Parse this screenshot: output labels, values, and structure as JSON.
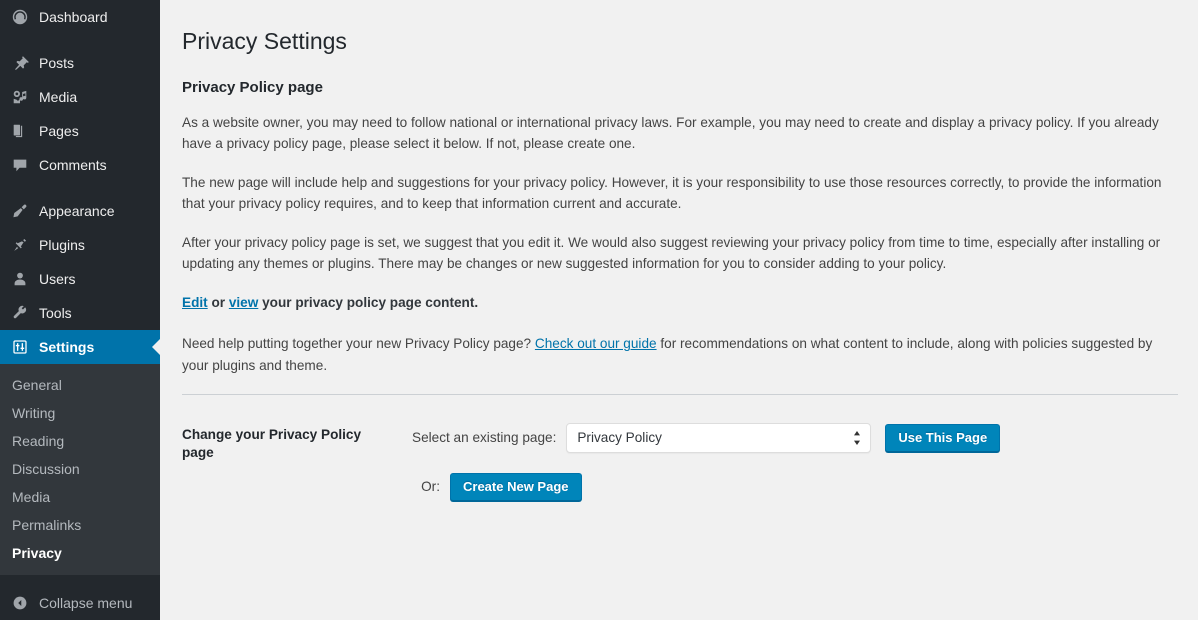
{
  "colors": {
    "menu_bg": "#23282d",
    "submenu_bg": "#32373c",
    "current_blue": "#0073aa",
    "button_blue": "#0085ba",
    "link_blue": "#0073aa",
    "content_bg": "#f1f1f1"
  },
  "sidebar": {
    "items": [
      {
        "label": "Dashboard",
        "icon": "dashboard-gauge-icon",
        "current": false
      },
      {
        "label": "Posts",
        "icon": "pushpin-icon",
        "current": false
      },
      {
        "label": "Media",
        "icon": "media-camera-music-icon",
        "current": false
      },
      {
        "label": "Pages",
        "icon": "pages-stack-icon",
        "current": false
      },
      {
        "label": "Comments",
        "icon": "comment-bubble-icon",
        "current": false
      },
      {
        "label": "Appearance",
        "icon": "paintbrush-icon",
        "current": false
      },
      {
        "label": "Plugins",
        "icon": "plug-icon",
        "current": false
      },
      {
        "label": "Users",
        "icon": "user-person-icon",
        "current": false
      },
      {
        "label": "Tools",
        "icon": "wrench-icon",
        "current": false
      },
      {
        "label": "Settings",
        "icon": "settings-sliders-icon",
        "current": true
      }
    ],
    "submenu": [
      {
        "label": "General",
        "current": false
      },
      {
        "label": "Writing",
        "current": false
      },
      {
        "label": "Reading",
        "current": false
      },
      {
        "label": "Discussion",
        "current": false
      },
      {
        "label": "Media",
        "current": false
      },
      {
        "label": "Permalinks",
        "current": false
      },
      {
        "label": "Privacy",
        "current": true
      }
    ],
    "collapse": {
      "label": "Collapse menu",
      "icon": "collapse-left-arrow-icon"
    }
  },
  "main": {
    "page_title": "Privacy Settings",
    "section_title": "Privacy Policy page",
    "paragraph_1": "As a website owner, you may need to follow national or international privacy laws. For example, you may need to create and display a privacy policy. If you already have a privacy policy page, please select it below. If not, please create one.",
    "paragraph_2": "The new page will include help and suggestions for your privacy policy. However, it is your responsibility to use those resources correctly, to provide the information that your privacy policy requires, and to keep that information current and accurate.",
    "paragraph_3": "After your privacy policy page is set, we suggest that you edit it. We would also suggest reviewing your privacy policy from time to time, especially after installing or updating any themes or plugins. There may be changes or new suggested information for you to consider adding to your policy.",
    "edit_line": {
      "edit_link": "Edit",
      "between": " or ",
      "view_link": "view",
      "tail": " your privacy policy page content."
    },
    "help_line": {
      "before": "Need help putting together your new Privacy Policy page? ",
      "guide_link": "Check out our guide",
      "after": " for recommendations on what content to include, along with policies suggested by your plugins and theme."
    },
    "form": {
      "row_label": "Change your Privacy Policy page",
      "select_label": "Select an existing page:",
      "select_value": "Privacy Policy",
      "select_options": [
        "Privacy Policy"
      ],
      "use_button": "Use This Page",
      "or_label": "Or:",
      "create_button": "Create New Page"
    }
  }
}
